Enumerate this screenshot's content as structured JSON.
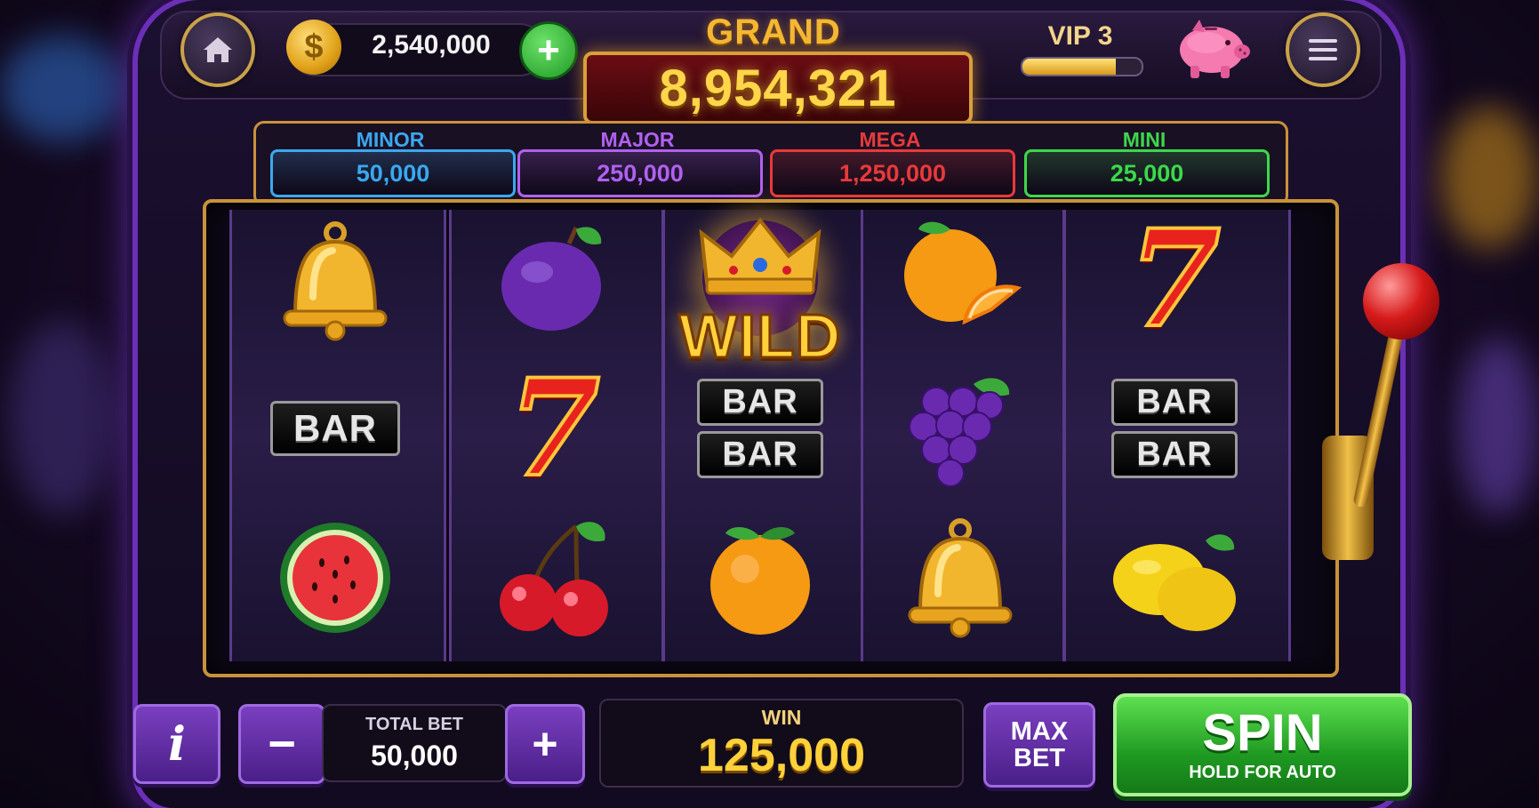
{
  "header": {
    "home_icon": "home-icon",
    "coin_icon": "dollar-coin-icon",
    "balance": "2,540,000",
    "add_coins_icon": "plus-icon",
    "grand_label": "GRAND",
    "grand_value": "8,954,321",
    "vip_label": "VIP 3",
    "vip_progress": 0.78,
    "piggy_icon": "piggy-bank-icon",
    "menu_icon": "menu-icon"
  },
  "jackpots": [
    {
      "label": "MINOR",
      "value": "50,000",
      "color": "#3aa8f0"
    },
    {
      "label": "MAJOR",
      "value": "250,000",
      "color": "#b061f0"
    },
    {
      "label": "MEGA",
      "value": "1,250,000",
      "color": "#e83a3a"
    },
    {
      "label": "MINI",
      "value": "25,000",
      "color": "#3cd84a"
    }
  ],
  "reels": [
    [
      "bell",
      "bar",
      "watermelon"
    ],
    [
      "plum",
      "seven",
      "cherries"
    ],
    [
      "wild",
      "double-bar",
      "orange"
    ],
    [
      "orange-slice",
      "grapes",
      "bell"
    ],
    [
      "seven",
      "double-bar",
      "lemons"
    ]
  ],
  "symbols": {
    "bar_text": "BAR",
    "seven_text": "7",
    "wild_text": "WILD"
  },
  "controls": {
    "info_label": "i",
    "minus_label": "−",
    "total_bet_label": "TOTAL BET",
    "total_bet_value": "50,000",
    "plus_label": "+",
    "win_label": "WIN",
    "win_value": "125,000",
    "max_bet_line1": "MAX",
    "max_bet_line2": "BET",
    "spin_label": "SPIN",
    "spin_sub": "HOLD FOR AUTO"
  }
}
